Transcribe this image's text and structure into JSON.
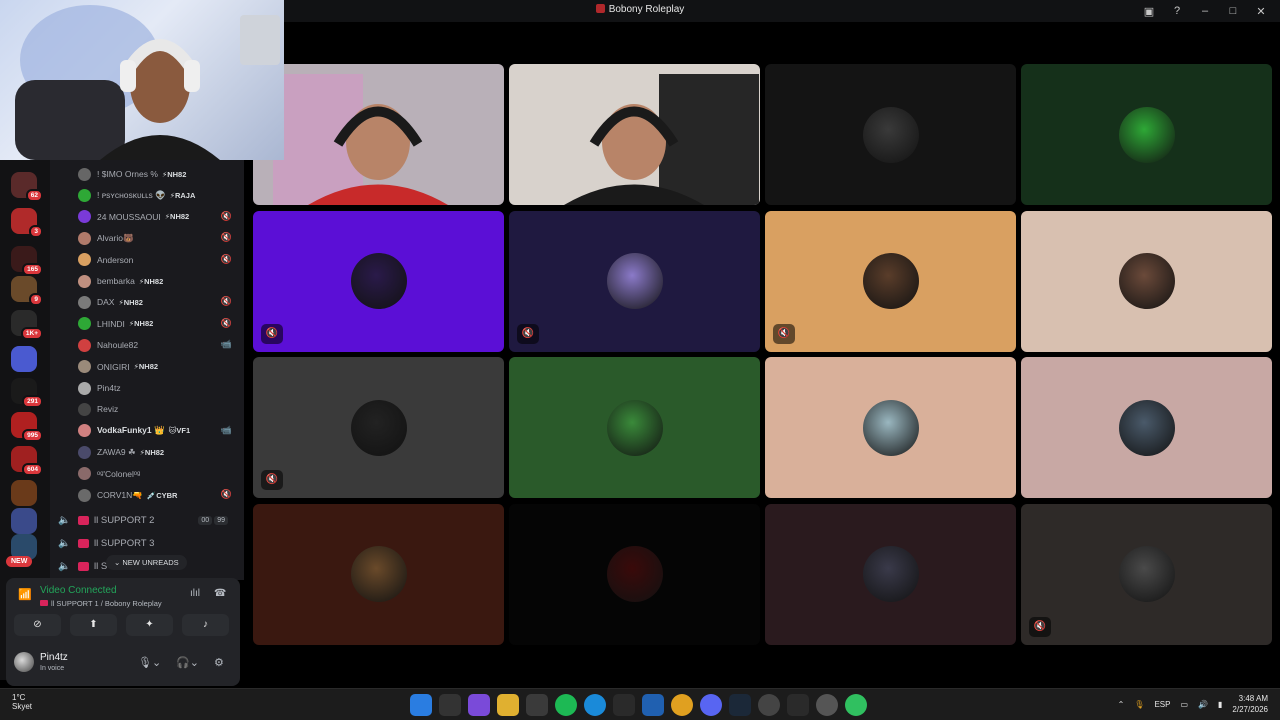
{
  "window": {
    "title": "Bobony Roleplay"
  },
  "servers": [
    {
      "badge": "62"
    },
    {
      "badge": "3"
    },
    {
      "badge": "165"
    },
    {
      "badge": "9"
    },
    {
      "badge": "1K+"
    },
    {
      "badge": ""
    },
    {
      "badge": "291"
    },
    {
      "badge": "995"
    },
    {
      "badge": "604"
    },
    {
      "badge": ""
    },
    {
      "badge": ""
    },
    {
      "badge": ""
    }
  ],
  "new_label": "NEW",
  "members": [
    {
      "name": "! $IMO Ornes %",
      "tag": "⚡NH82",
      "status": ""
    },
    {
      "name": "! ᴘsʏᴄʜᴏsᴋᴜʟʟs 👽",
      "tag": "⚡RAJA",
      "status": ""
    },
    {
      "name": "24 MOUSSAOUI",
      "tag": "⚡NH82",
      "status": "🔇"
    },
    {
      "name": "Alvario🐻",
      "tag": "",
      "status": "🔇"
    },
    {
      "name": "Anderson",
      "tag": "",
      "status": "🔇"
    },
    {
      "name": "bembarka",
      "tag": "⚡NH82",
      "status": ""
    },
    {
      "name": "DAX",
      "tag": "⚡NH82",
      "status": "🔇"
    },
    {
      "name": "LHINDI",
      "tag": "⚡NH82",
      "status": "🔇"
    },
    {
      "name": "Nahoule82",
      "tag": "",
      "status": "📹"
    },
    {
      "name": "ONIGIRI",
      "tag": "⚡NH82",
      "status": ""
    },
    {
      "name": "Pin4tz",
      "tag": "",
      "status": ""
    },
    {
      "name": "Reviz",
      "tag": "",
      "status": ""
    },
    {
      "name": "VodkaFunky1 👑",
      "tag": "🐱VF1",
      "status": "📹"
    },
    {
      "name": "ZAWA9 ☘",
      "tag": "⚡NH82",
      "status": ""
    },
    {
      "name": "ᵒᵍ'Colonelᵒᵍ",
      "tag": "",
      "status": ""
    },
    {
      "name": "CORV1N🔫",
      "tag": "💉CYBR",
      "status": "🔇"
    }
  ],
  "voice_channels": [
    {
      "name": "ll SUPPORT 2",
      "counts": [
        "00",
        "99"
      ]
    },
    {
      "name": "ll SUPPORT 3",
      "counts": []
    },
    {
      "name": "ll S",
      "counts": []
    }
  ],
  "new_unreads": "NEW UNREADS",
  "voice": {
    "status": "Video Connected",
    "channel": "ll SUPPORT 1 / Bobony Roleplay"
  },
  "user": {
    "name": "Pin4tz",
    "status": "In voice"
  },
  "tiles": [
    {
      "bg": "#1a1a1a",
      "avatar": "#4a4a4a",
      "muted": false,
      "camera": true
    },
    {
      "bg": "#1a1a1a",
      "avatar": "#4a4a4a",
      "muted": false,
      "camera": true
    },
    {
      "bg": "#141414",
      "avatar": "#3a3a3a",
      "muted": false,
      "camera": false
    },
    {
      "bg": "#15301a",
      "avatar": "#2ea836",
      "muted": false,
      "camera": false
    },
    {
      "bg": "#5b0fd6",
      "avatar": "#2a1a4a",
      "muted": true,
      "camera": false
    },
    {
      "bg": "#1f1940",
      "avatar": "#8b7ac9",
      "muted": true,
      "camera": false
    },
    {
      "bg": "#d9a061",
      "avatar": "#5a3d2a",
      "muted": true,
      "camera": false
    },
    {
      "bg": "#d8c0b0",
      "avatar": "#6b4a3a",
      "muted": false,
      "camera": false
    },
    {
      "bg": "#3a3a3a",
      "avatar": "#222222",
      "muted": true,
      "camera": false
    },
    {
      "bg": "#2a5a2a",
      "avatar": "#3a8a3a",
      "muted": false,
      "camera": false
    },
    {
      "bg": "#d9b09a",
      "avatar": "#9ab7c0",
      "muted": false,
      "camera": false
    },
    {
      "bg": "#c8a8a4",
      "avatar": "#4a5a6a",
      "muted": false,
      "camera": false
    },
    {
      "bg": "#3a1810",
      "avatar": "#6a4a2a",
      "muted": false,
      "camera": false
    },
    {
      "bg": "#050505",
      "avatar": "#3a0a0a",
      "muted": false,
      "camera": false
    },
    {
      "bg": "#2a1a1e",
      "avatar": "#3a3a4a",
      "muted": false,
      "camera": false
    },
    {
      "bg": "#2e2a28",
      "avatar": "#4a4a4a",
      "muted": true,
      "camera": false
    }
  ],
  "taskbar": {
    "temp": "1°C",
    "location": "Skyet",
    "lang": "ESP",
    "time": "3:48 AM",
    "date": "2/27/2026"
  }
}
